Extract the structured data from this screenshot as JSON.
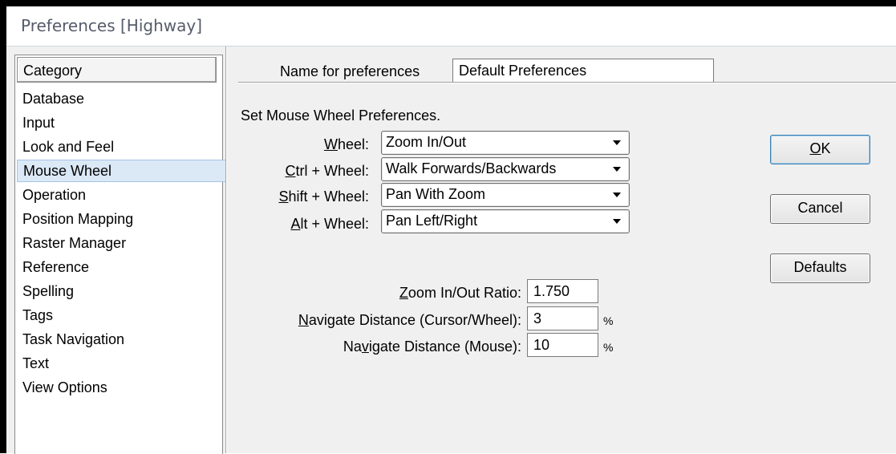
{
  "window": {
    "title": "Preferences [Highway]"
  },
  "category": {
    "header": "Category",
    "items": [
      "Database",
      "Input",
      "Look and Feel",
      "Mouse Wheel",
      "Operation",
      "Position Mapping",
      "Raster Manager",
      "Reference",
      "Spelling",
      "Tags",
      "Task Navigation",
      "Text",
      "View Options"
    ],
    "selected": "Mouse Wheel"
  },
  "preferences_name": {
    "label": "Name for preferences",
    "value": "Default Preferences"
  },
  "mouse_wheel": {
    "heading": "Set Mouse Wheel Preferences.",
    "wheel": {
      "mnemonic": "W",
      "label_rest": "heel:",
      "value": "Zoom In/Out"
    },
    "ctrl_wheel": {
      "mnemonic": "C",
      "label_rest": "trl + Wheel:",
      "value": "Walk Forwards/Backwards"
    },
    "shift_wheel": {
      "mnemonic": "S",
      "label_rest": "hift + Wheel:",
      "value": "Pan With Zoom"
    },
    "alt_wheel": {
      "mnemonic": "A",
      "label_rest": "lt + Wheel:",
      "value": "Pan Left/Right"
    },
    "zoom_ratio": {
      "mnemonic": "Z",
      "label_rest": "oom In/Out Ratio:",
      "value": "1.750"
    },
    "nav_cursor": {
      "mnemonic": "N",
      "label_rest": "avigate Distance (Cursor/Wheel):",
      "value": "3",
      "unit": "%"
    },
    "nav_mouse": {
      "label_pre": "Na",
      "mnemonic": "v",
      "label_rest": "igate Distance (Mouse):",
      "value": "10",
      "unit": "%"
    }
  },
  "buttons": {
    "ok": {
      "mnemonic": "O",
      "rest": "K"
    },
    "cancel": "Cancel",
    "defaults": "Defaults"
  }
}
